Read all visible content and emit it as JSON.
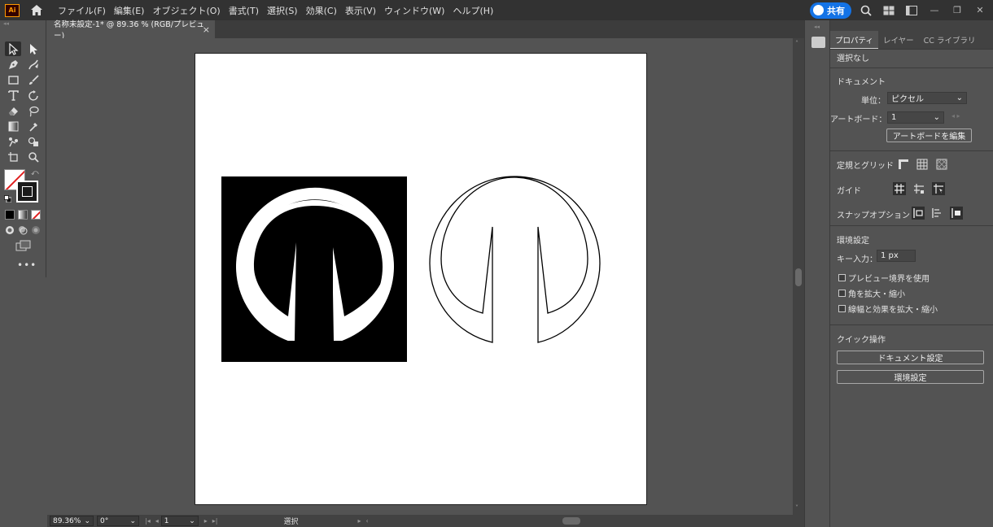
{
  "app": {
    "logo": "Ai"
  },
  "menu": [
    "ファイル(F)",
    "編集(E)",
    "オブジェクト(O)",
    "書式(T)",
    "選択(S)",
    "効果(C)",
    "表示(V)",
    "ウィンドウ(W)",
    "ヘルプ(H)"
  ],
  "share": {
    "label": "共有"
  },
  "document": {
    "tab_title": "名称未設定-1* @ 89.36 % (RGB/プレビュー)",
    "close": "×"
  },
  "status": {
    "zoom": "89.36%",
    "rotation": "0°",
    "artboard": "1",
    "tool": "選択"
  },
  "panel": {
    "tabs": [
      "プロパティ",
      "レイヤー",
      "CC ライブラリ"
    ],
    "selection": "選択なし",
    "document_heading": "ドキュメント",
    "unit_label": "単位：",
    "unit_value": "ピクセル",
    "artboard_label": "アートボード：",
    "artboard_value": "1",
    "edit_artboard_button": "アートボードを編集",
    "rulers_grids": "定規とグリッド",
    "guides": "ガイド",
    "snap_options": "スナップオプション",
    "preferences_heading": "環境設定",
    "key_input_label": "キー入力：",
    "key_input_value": "1 px",
    "check_preview_bounds": "プレビュー境界を使用",
    "check_scale_corners": "角を拡大・縮小",
    "check_scale_strokes": "線幅と効果を拡大・縮小",
    "quick_actions": "クイック操作",
    "doc_settings_button": "ドキュメント設定",
    "preferences_button": "環境設定"
  },
  "colors": {
    "accent": "#1473e6",
    "app_border": "#ff9a00"
  }
}
